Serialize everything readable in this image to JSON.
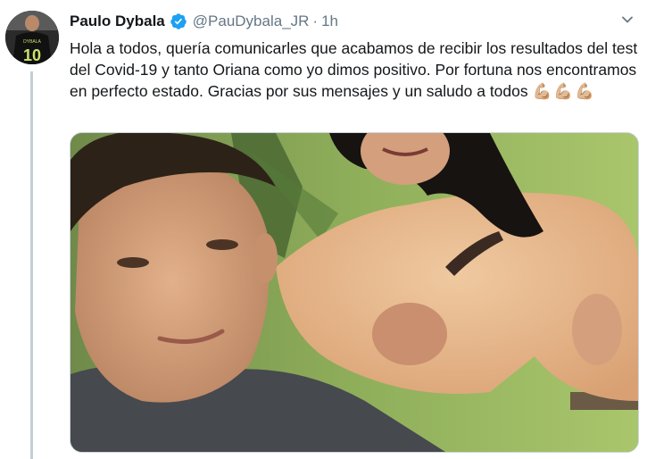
{
  "tweet": {
    "author_name": "Paulo Dybala",
    "handle": "@PauDybala_JR",
    "separator": "·",
    "time": "1h",
    "text": "Hola a todos, quería comunicarles que acabamos de recibir los resultados del test del Covid-19 y tanto Oriana como yo dimos positivo. Por fortuna nos encontramos en perfecto estado. Gracias por sus mensajes y un saludo a todos",
    "emojis": "💪🏼💪🏼💪🏼",
    "avatar_jersey_text": "DYBALA",
    "avatar_jersey_number": "10"
  },
  "icons": {
    "verified": "verified-badge-icon",
    "more": "chevron-down-icon"
  },
  "colors": {
    "verified": "#1da1f2",
    "secondary_text": "#657786",
    "thread_line": "#c4cfd6"
  }
}
